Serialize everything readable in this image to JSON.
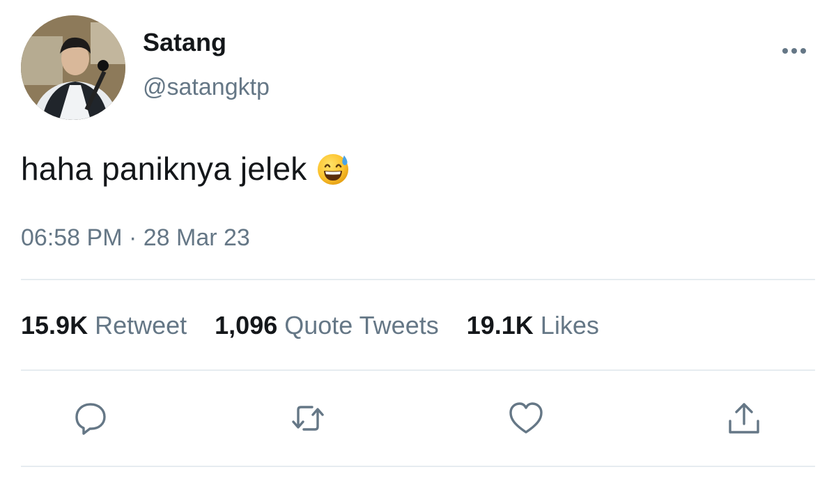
{
  "user": {
    "name": "Satang",
    "handle": "@satangktp"
  },
  "tweet": {
    "text": "haha paniknya jelek",
    "emoji": "grinning-face-with-sweat",
    "timestamp": "06:58 PM · 28 Mar 23"
  },
  "stats": {
    "retweets_count": "15.9K",
    "retweets_label": "Retweet",
    "quotes_count": "1,096",
    "quotes_label": "Quote Tweets",
    "likes_count": "19.1K",
    "likes_label": "Likes"
  },
  "actions": [
    "reply-icon",
    "retweet-icon",
    "like-icon",
    "share-icon"
  ],
  "colors": {
    "text": "#14171a",
    "secondary": "#657786",
    "divider": "#e6ecf0"
  }
}
